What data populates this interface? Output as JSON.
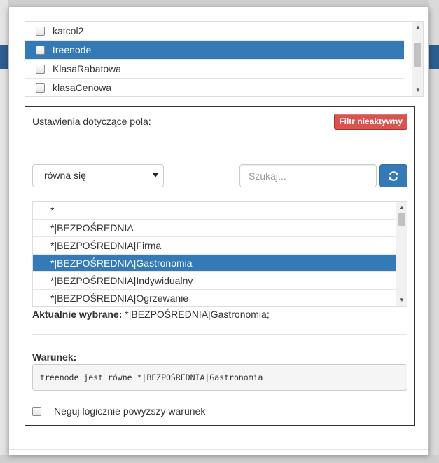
{
  "field_list": {
    "items": [
      {
        "label": "katcol2",
        "selected": false
      },
      {
        "label": "treenode",
        "selected": true
      },
      {
        "label": "KlasaRabatowa",
        "selected": false
      },
      {
        "label": "klasaCenowa",
        "selected": false
      }
    ]
  },
  "settings": {
    "title": "Ustawienia dotyczące pola:",
    "filter_button": "Filtr nieaktywny",
    "operator": "równa się",
    "search_placeholder": "Szukaj...",
    "values": [
      {
        "label": "*",
        "selected": false
      },
      {
        "label": "*|BEZPOŚREDNIA",
        "selected": false
      },
      {
        "label": "*|BEZPOŚREDNIA|Firma",
        "selected": false
      },
      {
        "label": "*|BEZPOŚREDNIA|Gastronomia",
        "selected": true
      },
      {
        "label": "*|BEZPOŚREDNIA|Indywidualny",
        "selected": false
      },
      {
        "label": "*|BEZPOŚREDNIA|Ogrzewanie",
        "selected": false
      }
    ],
    "current_label": "Aktualnie wybrane:",
    "current_value": " *|BEZPOŚREDNIA|Gastronomia;",
    "condition_label": "Warunek:",
    "condition_text": "treenode jest równe *|BEZPOŚREDNIA|Gastronomia",
    "negate_label": "Neguj logicznie powyższy warunek"
  },
  "colors": {
    "accent": "#337ab7",
    "danger": "#d9534f"
  }
}
